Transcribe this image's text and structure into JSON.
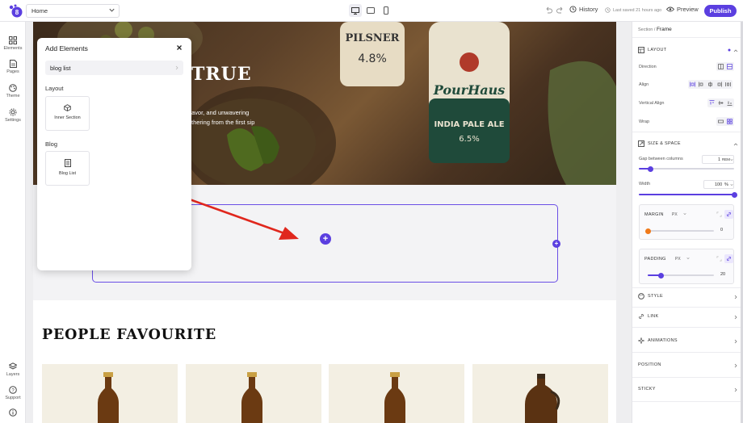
{
  "topbar": {
    "page_select": "Home",
    "history_label": "History",
    "saved_text": "Last saved 21 hours ago",
    "preview_label": "Preview",
    "publish_label": "Publish"
  },
  "leftbar": {
    "items": [
      {
        "label": "Elements"
      },
      {
        "label": "Pages"
      },
      {
        "label": "Theme"
      },
      {
        "label": "Settings"
      }
    ],
    "bottom_items": [
      {
        "label": "Layers"
      },
      {
        "label": "Support"
      }
    ]
  },
  "hero": {
    "title": "TRUE",
    "line1": "avor, and unwavering",
    "line2": "thering from the first sip"
  },
  "section3": {
    "title": "PEOPLE FAVOURITE"
  },
  "panel": {
    "title": "Add Elements",
    "search_value": "blog list",
    "groups": [
      {
        "title": "Layout",
        "items": [
          {
            "label": "Inner Section"
          }
        ]
      },
      {
        "title": "Blog",
        "items": [
          {
            "label": "Blog List"
          }
        ]
      }
    ]
  },
  "rightbar": {
    "crumb_parent": "Section",
    "crumb_current": "Frame",
    "layout": {
      "title": "LAYOUT",
      "direction_label": "Direction",
      "align_label": "Align",
      "valign_label": "Vertical Align",
      "wrap_label": "Wrap"
    },
    "size": {
      "title": "SIZE & SPACE",
      "gap_label": "Gap between columns",
      "gap_value": "1",
      "gap_unit": "REM",
      "gap_level": 0.12,
      "width_label": "Width",
      "width_value": "100",
      "width_unit": "%",
      "width_level": 1.0
    },
    "margin": {
      "label": "MARGIN",
      "unit": "PX",
      "value": "0",
      "level": 0.0
    },
    "padding": {
      "label": "PADDING",
      "unit": "PX",
      "value": "20",
      "level": 0.2
    },
    "sections": [
      {
        "title": "STYLE"
      },
      {
        "title": "LINK"
      },
      {
        "title": "ANIMATIONS"
      },
      {
        "title": "POSITION"
      },
      {
        "title": "STICKY"
      }
    ]
  },
  "colors": {
    "accent": "#5b3fe0",
    "margin_knob": "#f07a1a"
  }
}
